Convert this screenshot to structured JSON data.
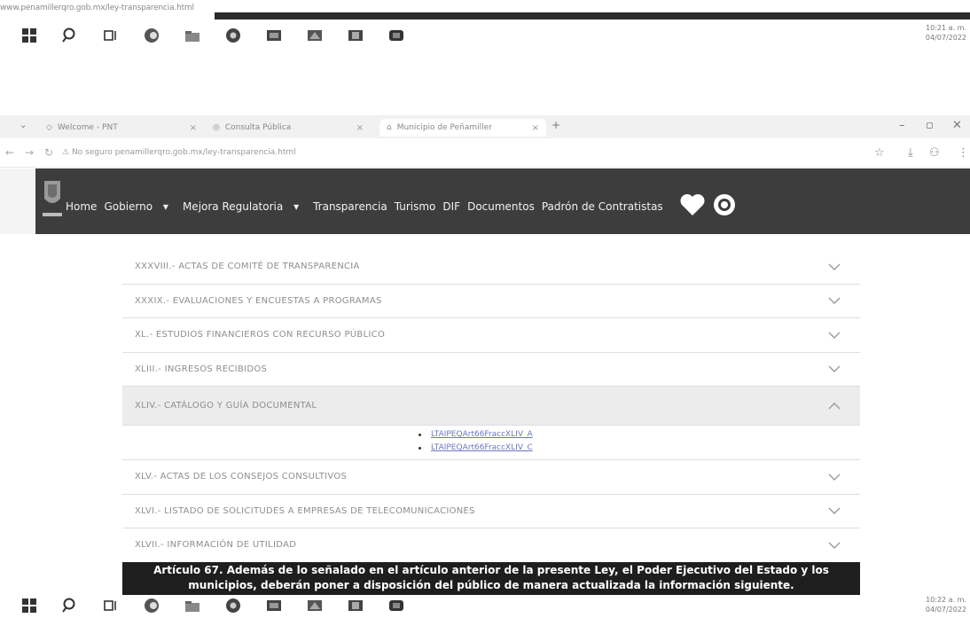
{
  "top": {
    "url": "www.penamillerqro.gob.mx/ley-transparencia.html",
    "clock_time": "10:21 a. m.",
    "clock_date": "04/07/2022"
  },
  "bottom": {
    "clock_time": "10:22 a. m.",
    "clock_date": "04/07/2022"
  },
  "browser": {
    "tabs": [
      {
        "label": "Welcome - PNT"
      },
      {
        "label": "Consulta Pública"
      },
      {
        "label": "Municipio de Peñamiller"
      }
    ],
    "new_tab": "+",
    "address": "No seguro   penamillerqro.gob.mx/ley-transparencia.html"
  },
  "site": {
    "nav": [
      "Home",
      "Gobierno",
      "Mejora Regulatoria",
      "Transparencia",
      "Turismo",
      "DIF",
      "Documentos",
      "Padrón de Contratistas"
    ],
    "dropdown_marker": "▾"
  },
  "accordion": {
    "items": [
      {
        "label": "XXXVIII.- ACTAS DE COMITÉ DE TRANSPARENCIA",
        "open": false
      },
      {
        "label": "XXXIX.- EVALUACIONES Y ENCUESTAS A PROGRAMAS",
        "open": false
      },
      {
        "label": "XL.- ESTUDIOS FINANCIEROS CON RECURSO PÚBLICO",
        "open": false
      },
      {
        "label": "XLIII.- INGRESOS RECIBIDOS",
        "open": false
      },
      {
        "label": "XLIV.- CATÁLOGO Y GUÍA DOCUMENTAL",
        "open": true,
        "links": [
          "LTAIPEQArt66FraccXLIV_A",
          "LTAIPEQArt66FraccXLIV_C"
        ]
      },
      {
        "label": "XLV.- ACTAS DE LOS CONSEJOS CONSULTIVOS",
        "open": false
      },
      {
        "label": "XLVI.- LISTADO DE SOLICITUDES A EMPRESAS DE TELECOMUNICACIONES",
        "open": false
      },
      {
        "label": "XLVII.- INFORMACIÓN DE UTILIDAD",
        "open": false
      }
    ]
  },
  "caption": {
    "line1": "Artículo 67. Además de lo señalado en el artículo anterior de la presente Ley, el Poder Ejecutivo del Estado y los",
    "line2": "municipios, deberán poner a disposición del público de manera actualizada la información siguiente."
  },
  "colors": {
    "header_bg": "#3d3d3d",
    "caption_bg": "#1e1e1e",
    "link": "#6b78c0"
  }
}
